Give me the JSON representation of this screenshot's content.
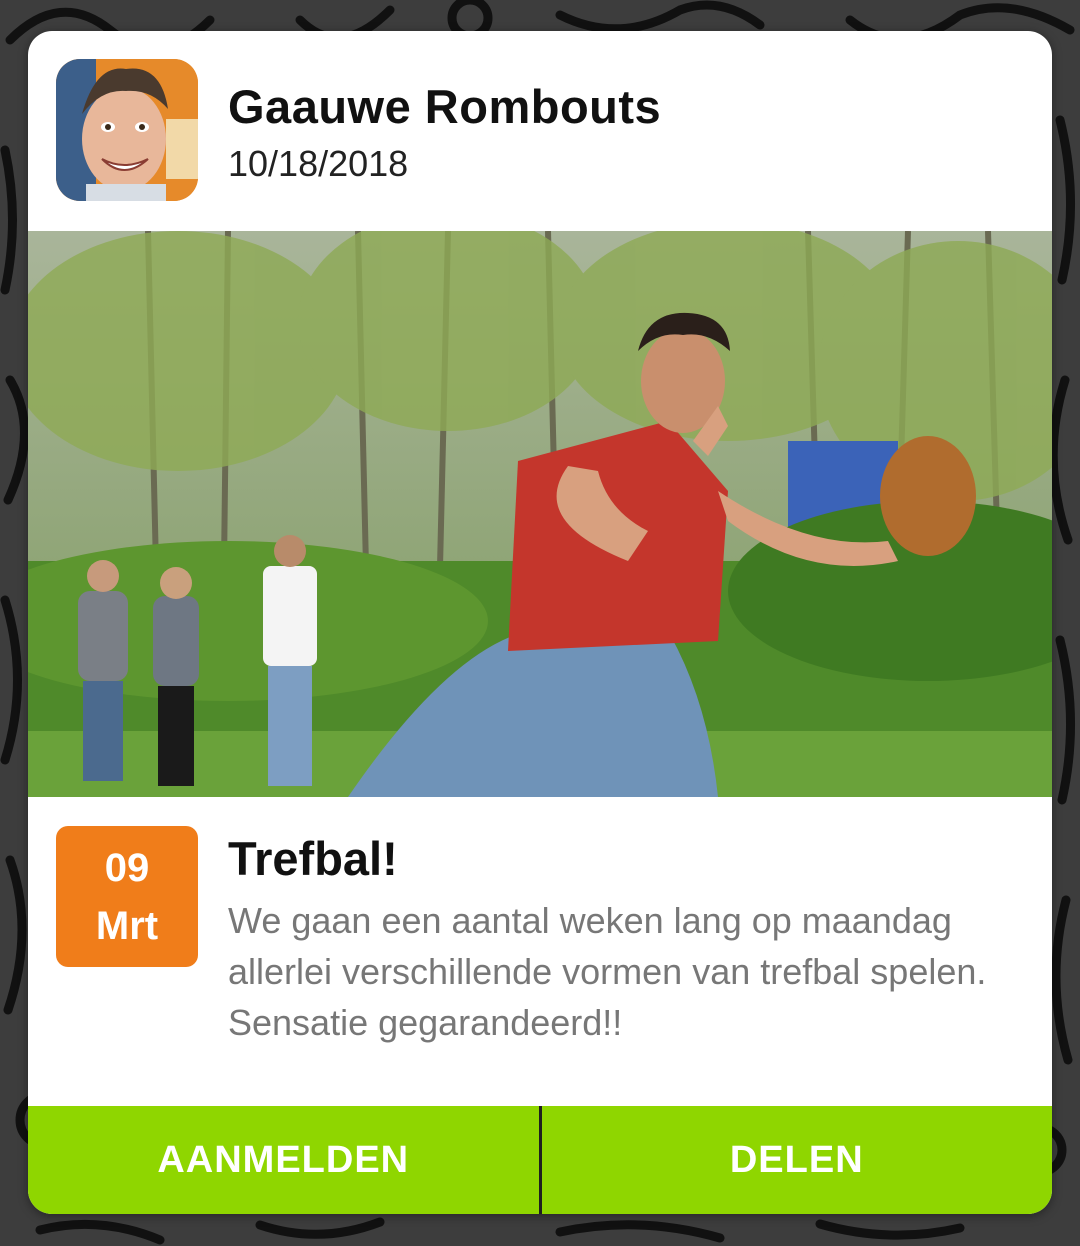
{
  "post": {
    "author": "Gaauwe Rombouts",
    "date": "10/18/2018"
  },
  "event": {
    "day": "09",
    "month": "Mrt",
    "title": "Trefbal!",
    "description": "We gaan een aantal weken lang op maandag allerlei verschillende vormen van trefbal spelen. Sensatie gegarandeerd!!"
  },
  "actions": {
    "register_label": "AANMELDEN",
    "share_label": "DELEN"
  },
  "colors": {
    "accent_green": "#8fd600",
    "badge_orange": "#f07d1a",
    "background": "#3d3d3d"
  }
}
